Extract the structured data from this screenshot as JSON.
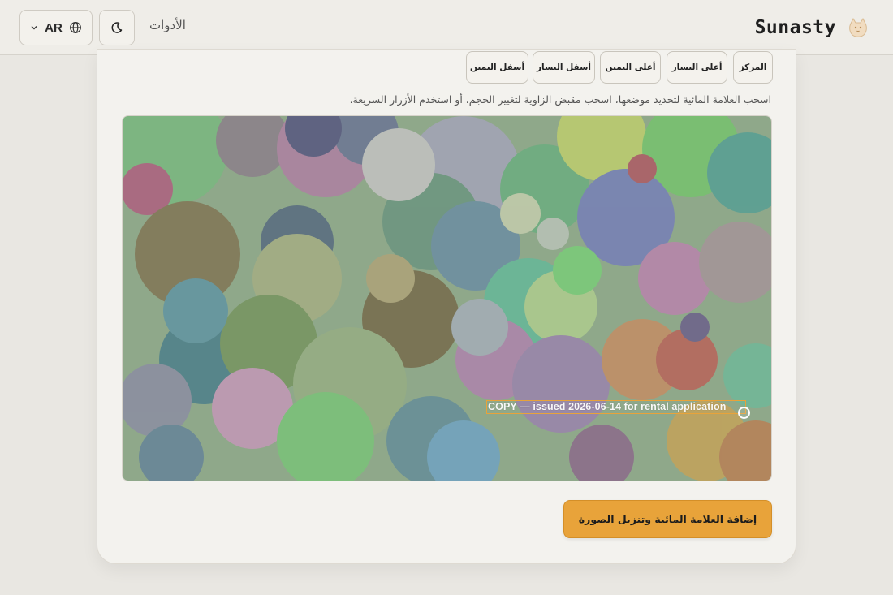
{
  "header": {
    "brand": "Sunasty",
    "logo_icon": "cat-icon",
    "tools_label": "الأدوات",
    "language_code": "AR",
    "language_icon": "globe-icon",
    "theme_icon": "moon-icon"
  },
  "positions": {
    "center": "المركز",
    "top_left": "أعلى  اليسار",
    "top_right": "أعلى  اليمين",
    "bottom_left": "أسفل  اليسار",
    "bottom_right": "أسفل  اليمين"
  },
  "hint": "اسحب العلامة المائية لتحديد موضعها، اسحب مقبض الزاوية لتغيير الحجم، أو استخدم الأزرار السريعة.",
  "watermark": {
    "text": "COPY — issued 2026-06-14 for rental application",
    "selection_color": "#e8a33a"
  },
  "apply_button": "إضافة  العلامة  المائية  وتنزيل  الصورة",
  "colors": {
    "accent": "#e8a33a",
    "background": "#e9e7e2",
    "card": "#f3f2ee"
  }
}
